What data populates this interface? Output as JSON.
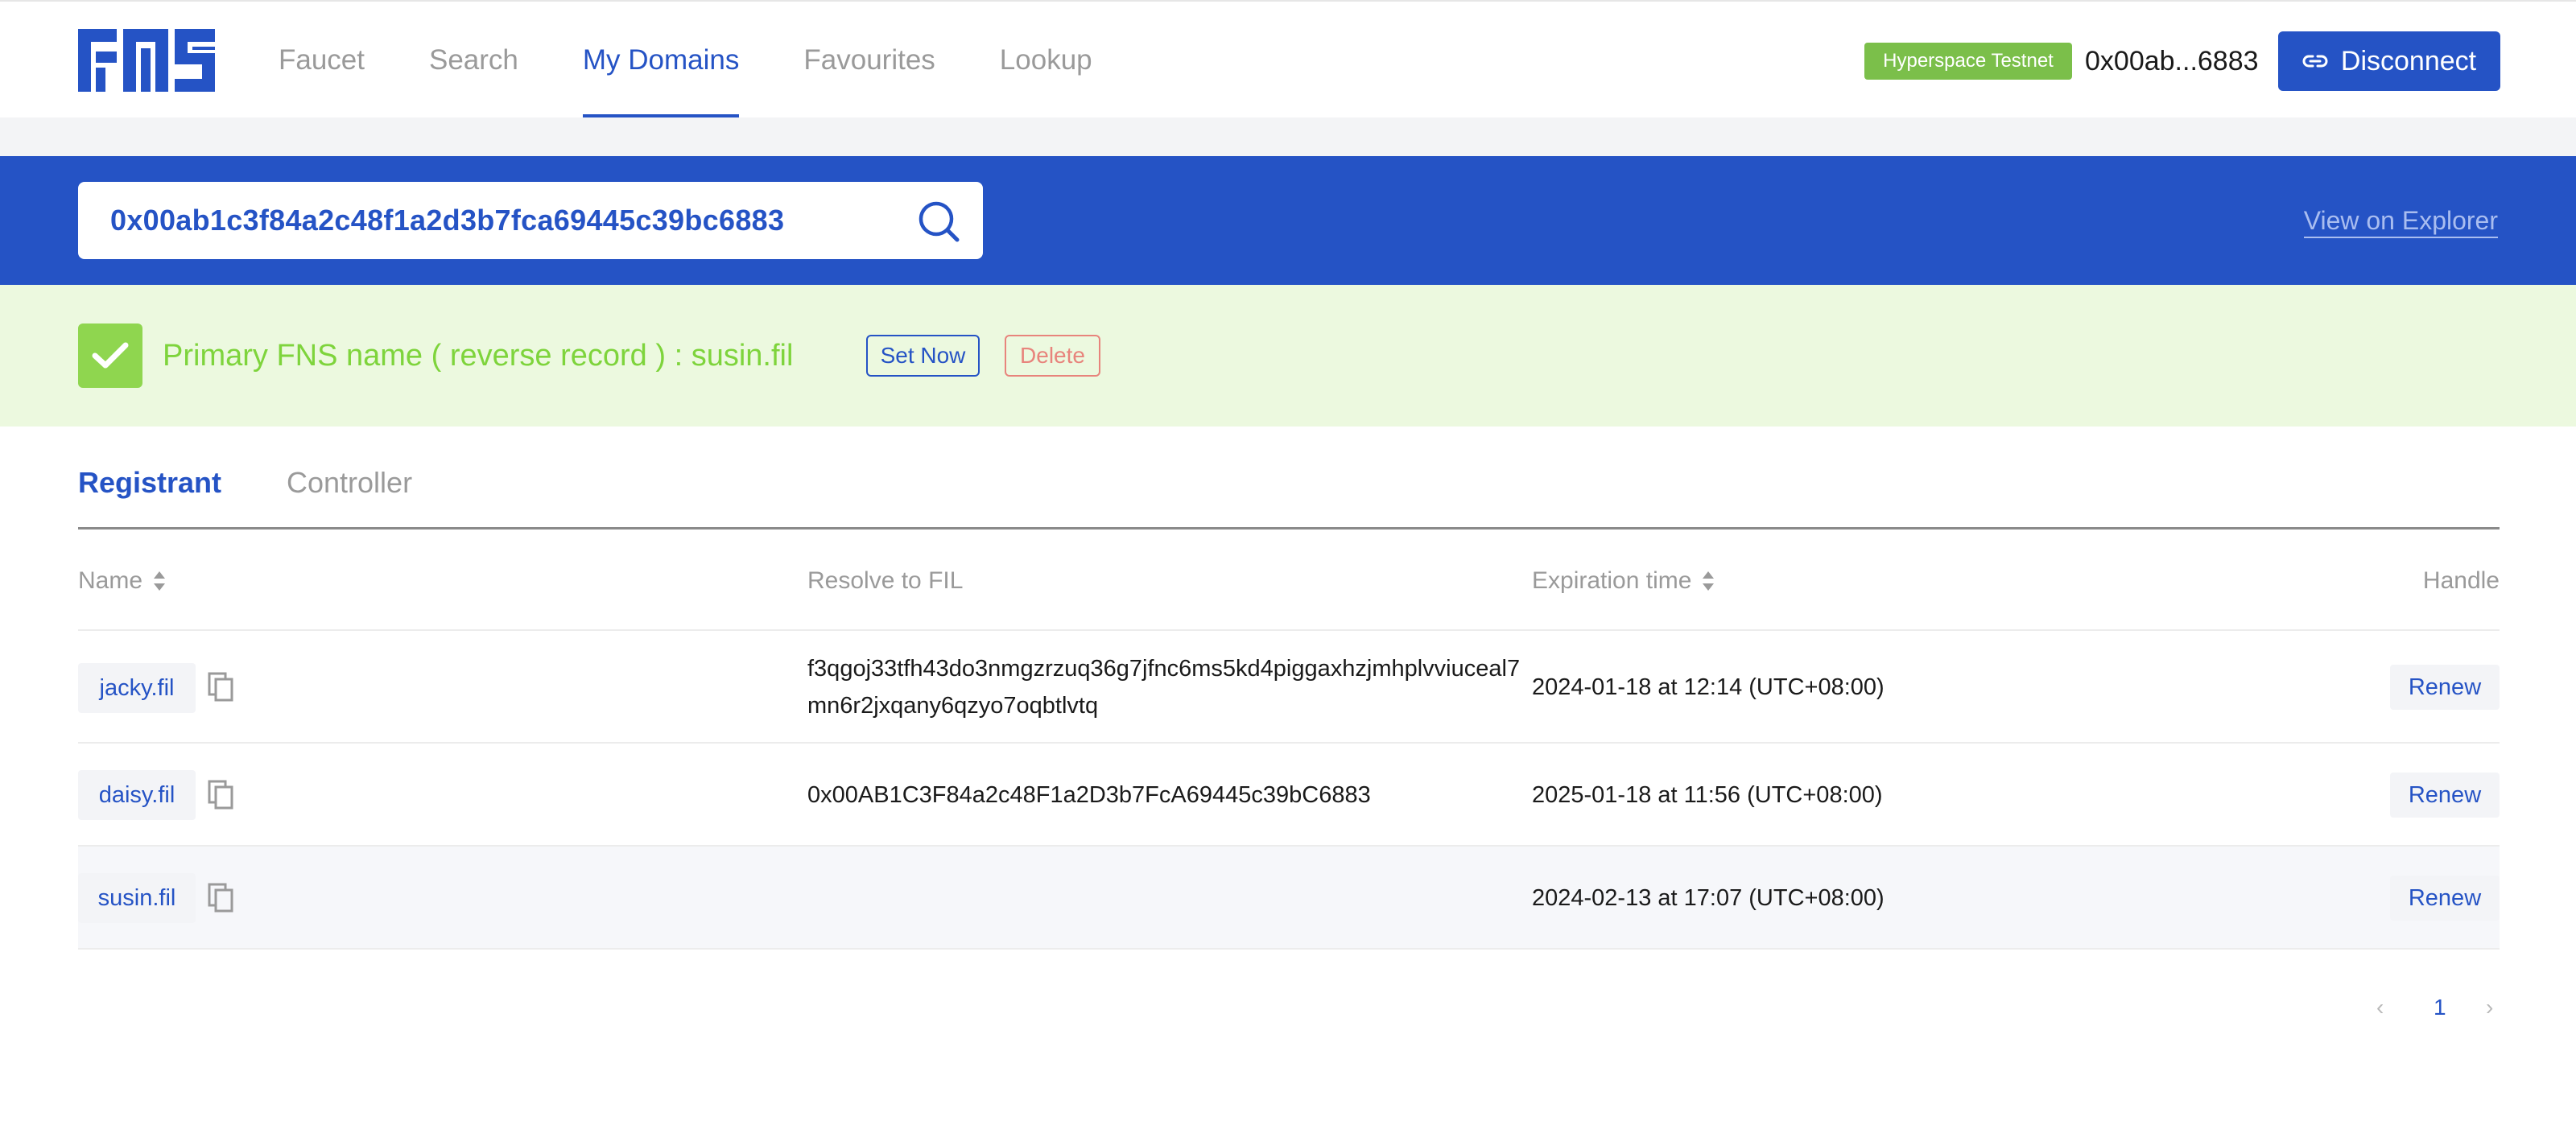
{
  "header": {
    "nav": [
      {
        "label": "Faucet"
      },
      {
        "label": "Search"
      },
      {
        "label": "My Domains",
        "active": true
      },
      {
        "label": "Favourites"
      },
      {
        "label": "Lookup"
      }
    ],
    "network_badge": "Hyperspace Testnet",
    "address_short": "0x00ab...6883",
    "disconnect_label": "Disconnect"
  },
  "search": {
    "value": "0x00ab1c3f84a2c48f1a2d3b7fca69445c39bc6883",
    "explorer_link": "View on Explorer"
  },
  "notice": {
    "text": "Primary FNS name ( reverse record ) : susin.fil",
    "set_now": "Set Now",
    "delete": "Delete"
  },
  "tabs": [
    {
      "label": "Registrant",
      "active": true
    },
    {
      "label": "Controller",
      "active": false
    }
  ],
  "table": {
    "headers": {
      "name": "Name",
      "resolve": "Resolve to FIL",
      "expiration": "Expiration time",
      "handle": "Handle"
    },
    "rows": [
      {
        "name": "jacky.fil",
        "resolve": "f3qgoj33tfh43do3nmgzrzuq36g7jfnc6ms5kd4piggaxhzjmhplvviuceal7mn6r2jxqany6qzyo7oqbtlvtq",
        "expiration": "2024-01-18 at 12:14 (UTC+08:00)",
        "action": "Renew"
      },
      {
        "name": "daisy.fil",
        "resolve": "0x00AB1C3F84a2c48F1a2D3b7FcA69445c39bC6883",
        "expiration": "2025-01-18 at 11:56 (UTC+08:00)",
        "action": "Renew"
      },
      {
        "name": "susin.fil",
        "resolve": "",
        "expiration": "2024-02-13 at 17:07 (UTC+08:00)",
        "action": "Renew"
      }
    ]
  },
  "pagination": {
    "prev": "‹",
    "current": "1",
    "next": "›"
  },
  "colors": {
    "primary": "#2553c5",
    "badge_green": "#7bbf4a",
    "notice_bg": "#ecf9df",
    "notice_text": "#7ed43c",
    "delete_red": "#e8847c"
  }
}
